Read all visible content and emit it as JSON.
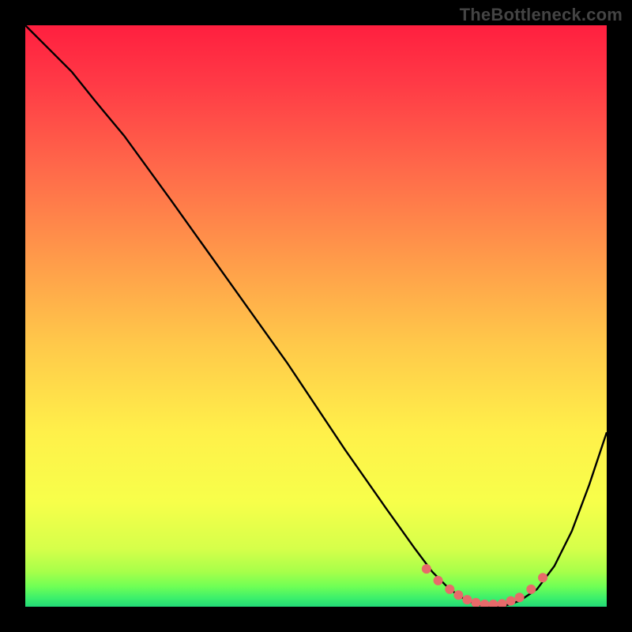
{
  "watermark": "TheBottleneck.com",
  "chart_data": {
    "type": "line",
    "title": "",
    "xlabel": "",
    "ylabel": "",
    "xlim": [
      0,
      100
    ],
    "ylim": [
      0,
      100
    ],
    "series": [
      {
        "name": "curve",
        "x": [
          0,
          4,
          8,
          12,
          17,
          25,
          35,
          45,
          55,
          62,
          67,
          70,
          73,
          76,
          79,
          82,
          85,
          88,
          91,
          94,
          97,
          100
        ],
        "y": [
          100,
          96,
          92,
          87,
          81,
          70,
          56,
          42,
          27,
          17,
          10,
          6,
          3,
          1,
          0,
          0,
          1,
          3,
          7,
          13,
          21,
          30
        ]
      }
    ],
    "highlight": {
      "name": "highlight-dots",
      "x": [
        69,
        71,
        73,
        74.5,
        76,
        77.5,
        79,
        80.5,
        82,
        83.5,
        85,
        87,
        89
      ],
      "y": [
        6.5,
        4.5,
        3.0,
        2.0,
        1.2,
        0.7,
        0.4,
        0.4,
        0.5,
        1.0,
        1.6,
        3.0,
        5.0
      ]
    },
    "gradient_stops": [
      {
        "offset": 0.0,
        "color": "#ff1f3f"
      },
      {
        "offset": 0.1,
        "color": "#ff3a46"
      },
      {
        "offset": 0.25,
        "color": "#ff6a4a"
      },
      {
        "offset": 0.4,
        "color": "#ff9a4a"
      },
      {
        "offset": 0.55,
        "color": "#ffc94a"
      },
      {
        "offset": 0.7,
        "color": "#fff04a"
      },
      {
        "offset": 0.82,
        "color": "#f7ff4a"
      },
      {
        "offset": 0.9,
        "color": "#d6ff4a"
      },
      {
        "offset": 0.94,
        "color": "#a7ff4a"
      },
      {
        "offset": 0.965,
        "color": "#70ff55"
      },
      {
        "offset": 0.985,
        "color": "#3cf06b"
      },
      {
        "offset": 1.0,
        "color": "#22d877"
      }
    ],
    "dot_color": "#e76a6a",
    "curve_color": "#000000"
  }
}
